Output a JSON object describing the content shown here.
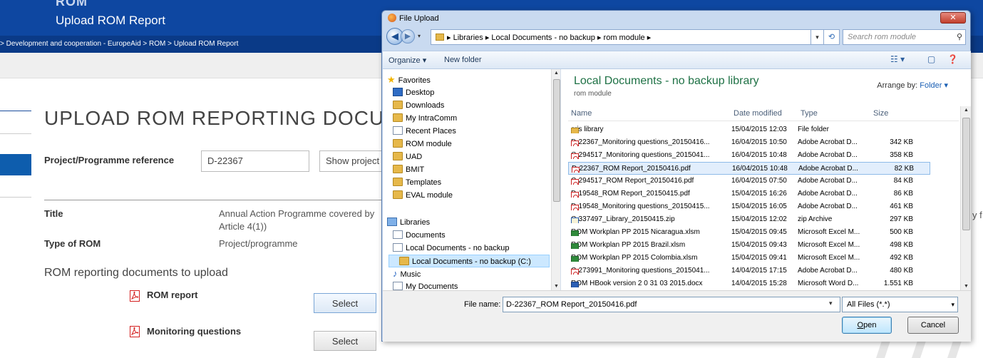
{
  "site": {
    "logo_text": "ROM",
    "page_title": "Upload ROM Report",
    "breadcrumb": "> Development and cooperation - EuropeAid > ROM > Upload ROM Report",
    "heading": "UPLOAD ROM REPORTING DOCU",
    "project_ref_label": "Project/Programme reference",
    "project_ref_value": "D-22367",
    "show_project_label": "Show project",
    "title_label": "Title",
    "title_value_line1": "Annual Action Programme covered by",
    "title_value_line2": "Article 4(1))",
    "type_label": "Type of ROM",
    "type_value": "Project/programme",
    "upload_section": "ROM reporting documents to upload",
    "doc1_label": "ROM report",
    "doc2_label": "Monitoring questions",
    "select_label": "Select",
    "right_edge_text": "y f"
  },
  "dialog": {
    "title": "File Upload",
    "close_label": "✕",
    "breadcrumb": "▸ Libraries ▸ Local Documents - no backup ▸ rom module ▸",
    "search_placeholder": "Search rom module",
    "toolbar": {
      "organize": "Organize ▾",
      "new_folder": "New folder"
    },
    "nav": {
      "favorites": "Favorites",
      "items": [
        "Desktop",
        "Downloads",
        "My IntraComm",
        "Recent Places",
        "ROM module",
        "UAD",
        "BMIT",
        "Templates",
        "EVAL module"
      ],
      "libraries": "Libraries",
      "lib_items": [
        "Documents",
        "Local Documents - no backup",
        "Local Documents - no backup (C:)",
        "Music",
        "My Documents"
      ]
    },
    "library_title": "Local Documents - no backup library",
    "library_sub": "rom module",
    "arrange_label": "Arrange by:",
    "arrange_value": "Folder ▾",
    "columns": {
      "name": "Name",
      "date": "Date modified",
      "type": "Type",
      "size": "Size"
    },
    "files": [
      {
        "name": "cris library",
        "date": "15/04/2015 12:03",
        "type": "File folder",
        "size": "",
        "icon": "folder-icon"
      },
      {
        "name": "D-22367_Monitoring questions_20150416...",
        "date": "16/04/2015 10:50",
        "type": "Adobe Acrobat D...",
        "size": "342 KB",
        "icon": "pdf-icon"
      },
      {
        "name": "C-294517_Monitoring questions_2015041...",
        "date": "16/04/2015 10:48",
        "type": "Adobe Acrobat D...",
        "size": "358 KB",
        "icon": "pdf-icon"
      },
      {
        "name": "D-22367_ROM Report_20150416.pdf",
        "date": "16/04/2015 10:48",
        "type": "Adobe Acrobat D...",
        "size": "82 KB",
        "icon": "pdf-icon"
      },
      {
        "name": "C-294517_ROM Report_20150416.pdf",
        "date": "16/04/2015 07:50",
        "type": "Adobe Acrobat D...",
        "size": "84 KB",
        "icon": "pdf-icon"
      },
      {
        "name": "D-19548_ROM Report_20150415.pdf",
        "date": "15/04/2015 16:26",
        "type": "Adobe Acrobat D...",
        "size": "86 KB",
        "icon": "pdf-icon"
      },
      {
        "name": "D-19548_Monitoring questions_20150415...",
        "date": "15/04/2015 16:05",
        "type": "Adobe Acrobat D...",
        "size": "461 KB",
        "icon": "pdf-icon"
      },
      {
        "name": "C-337497_Library_20150415.zip",
        "date": "15/04/2015 12:02",
        "type": "zip Archive",
        "size": "297 KB",
        "icon": "zip-icon"
      },
      {
        "name": "ROM Workplan PP 2015 Nicaragua.xlsm",
        "date": "15/04/2015 09:45",
        "type": "Microsoft Excel M...",
        "size": "500 KB",
        "icon": "excel-icon"
      },
      {
        "name": "ROM Workplan PP 2015 Brazil.xlsm",
        "date": "15/04/2015 09:43",
        "type": "Microsoft Excel M...",
        "size": "498 KB",
        "icon": "excel-icon"
      },
      {
        "name": "ROM Workplan PP 2015 Colombia.xlsm",
        "date": "15/04/2015 09:41",
        "type": "Microsoft Excel M...",
        "size": "492 KB",
        "icon": "excel-icon"
      },
      {
        "name": "C-273991_Monitoring questions_2015041...",
        "date": "14/04/2015 17:15",
        "type": "Adobe Acrobat D...",
        "size": "480 KB",
        "icon": "pdf-icon"
      },
      {
        "name": "ROM HBook version 2 0 31 03 2015.docx",
        "date": "14/04/2015 15:28",
        "type": "Microsoft Word D...",
        "size": "1.551 KB",
        "icon": "word-icon"
      }
    ],
    "selected_file_index": 3,
    "file_name_label": "File name:",
    "file_name_value": "D-22367_ROM Report_20150416.pdf",
    "file_type_value": "All Files (*.*)",
    "open_label": "Open",
    "cancel_label": "Cancel"
  },
  "colors": {
    "header_blue": "#0e47a1",
    "library_green": "#1e7145",
    "selection": "#cce8ff"
  }
}
